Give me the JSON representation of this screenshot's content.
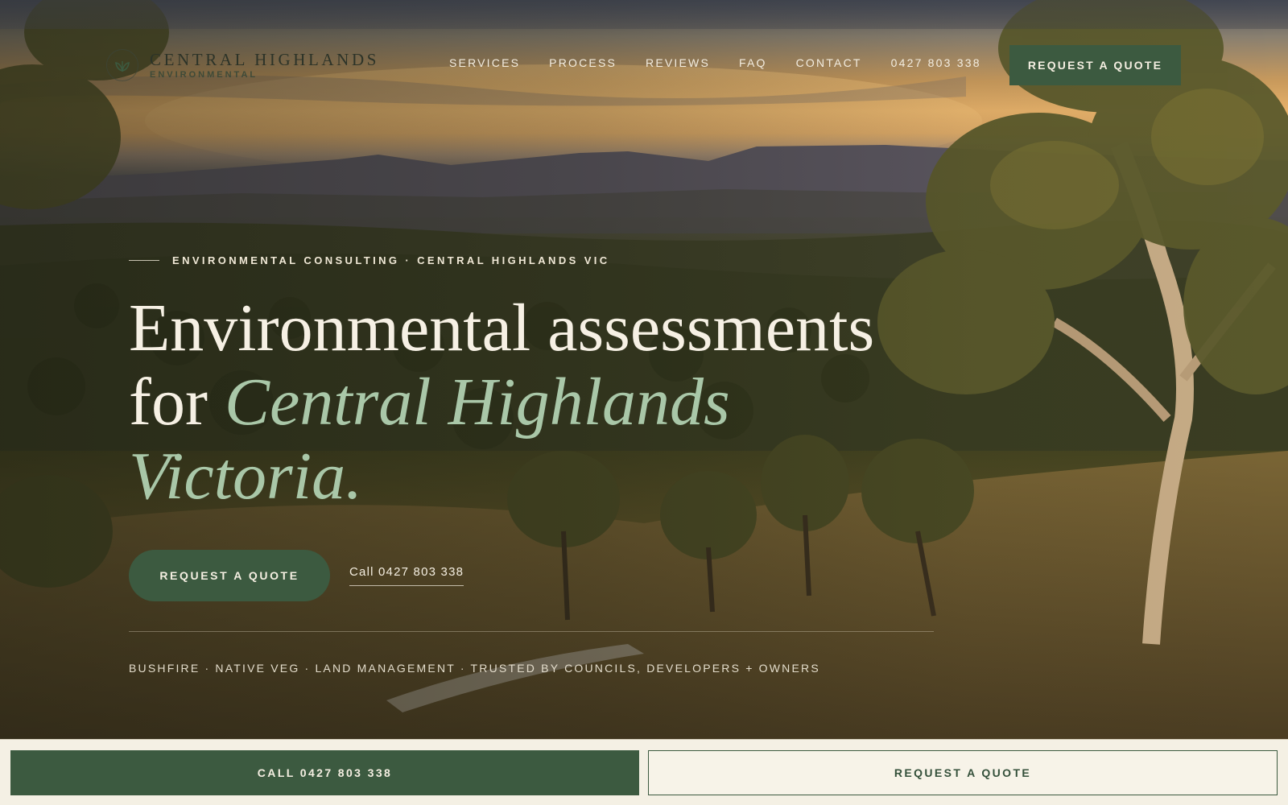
{
  "brand": {
    "name": "CENTRAL HIGHLANDS",
    "sub": "ENVIRONMENTAL",
    "logo_icon": "leaf-icon"
  },
  "nav": {
    "items": [
      {
        "label": "SERVICES"
      },
      {
        "label": "PROCESS"
      },
      {
        "label": "REVIEWS"
      },
      {
        "label": "FAQ"
      },
      {
        "label": "CONTACT"
      }
    ],
    "phone": "0427 803 338",
    "cta": "REQUEST A QUOTE"
  },
  "hero": {
    "eyebrow": "ENVIRONMENTAL CONSULTING · CENTRAL HIGHLANDS VIC",
    "headline_plain_1": "Environmental assessments",
    "headline_plain_2": "for ",
    "headline_em_1": "Central Highlands",
    "headline_em_2": "Victoria.",
    "cta_primary": "REQUEST A QUOTE",
    "cta_call": "Call 0427 803 338",
    "trust": "BUSHFIRE · NATIVE VEG · LAND MANAGEMENT · TRUSTED BY COUNCILS, DEVELOPERS + OWNERS"
  },
  "bottombar": {
    "call": "CALL 0427 803 338",
    "quote": "REQUEST A QUOTE"
  },
  "colors": {
    "accent_green": "#3c5a40",
    "headline_em": "#a9c7a8",
    "cream": "#f4f0e4"
  }
}
